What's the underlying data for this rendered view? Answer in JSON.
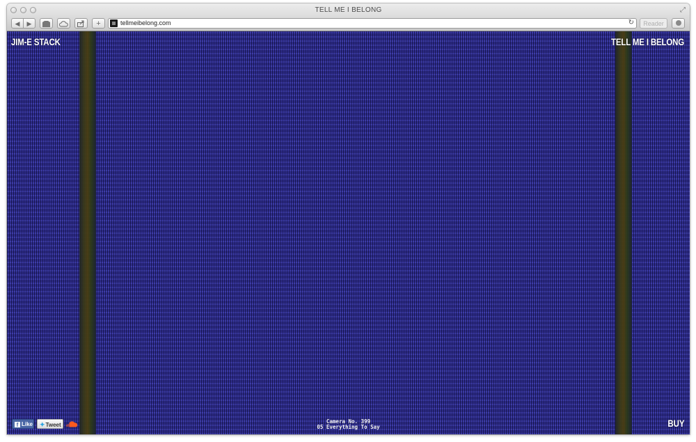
{
  "window": {
    "title": "TELL ME I BELONG"
  },
  "toolbar": {
    "back_icon": "◀",
    "forward_icon": "▶",
    "add_icon": "+",
    "url": "tellmeibelong.com",
    "reader_label": "Reader",
    "reload_icon": "↻"
  },
  "page": {
    "artist": "JIM-E STACK",
    "album": "TELL ME I BELONG",
    "buy_label": "BUY",
    "like_label": "Like",
    "tweet_label": "Tweet",
    "caption_line1": "Camera No. 399",
    "caption_line2": "05 Everything To Say",
    "colors": {
      "background": "#2f2d8a",
      "stripe": "#4a3d10",
      "facebook": "#4a66a5",
      "soundcloud": "#ff5a1f",
      "twitter": "#2aa3e0"
    }
  }
}
